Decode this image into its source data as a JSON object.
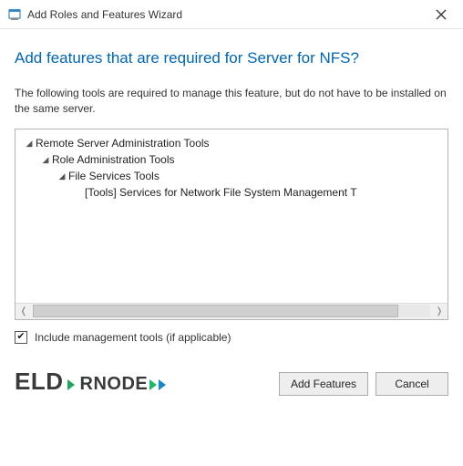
{
  "titlebar": {
    "title": "Add Roles and Features Wizard"
  },
  "heading": "Add features that are required for Server for NFS?",
  "description": "The following tools are required to manage this feature, but do not have to be installed on the same server.",
  "tree": {
    "n0": "Remote Server Administration Tools",
    "n1": "Role Administration Tools",
    "n2": "File Services Tools",
    "n3": "[Tools] Services for Network File System Management T"
  },
  "checkbox": {
    "label": "Include management tools (if applicable)",
    "checked": true
  },
  "buttons": {
    "add": "Add Features",
    "cancel": "Cancel"
  },
  "logo": {
    "pre": "ELD",
    "mid": "R",
    "post": "NODE"
  }
}
